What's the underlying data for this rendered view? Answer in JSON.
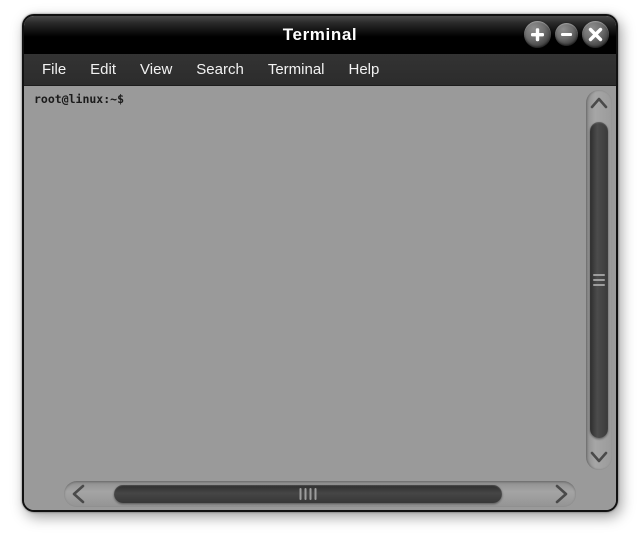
{
  "window": {
    "title": "Terminal",
    "controls": [
      {
        "name": "maximize-button",
        "icon": "plus-icon"
      },
      {
        "name": "minimize-button",
        "icon": "minus-icon"
      },
      {
        "name": "close-button",
        "icon": "close-icon"
      }
    ]
  },
  "menubar": {
    "items": [
      {
        "label": "File"
      },
      {
        "label": "Edit"
      },
      {
        "label": "View"
      },
      {
        "label": "Search"
      },
      {
        "label": "Terminal"
      },
      {
        "label": "Help"
      }
    ]
  },
  "terminal": {
    "prompt": "root@linux:~$",
    "lines": [
      "root@linux:~$"
    ],
    "background_color": "#9a9a9a",
    "text_color": "#1b1b1b"
  },
  "scrollbars": {
    "vertical": {
      "up_arrow_icon": "chevron-up-icon",
      "down_arrow_icon": "chevron-down-icon",
      "grip_lines": 3
    },
    "horizontal": {
      "left_arrow_icon": "chevron-left-icon",
      "right_arrow_icon": "chevron-right-icon",
      "grip_lines": 4
    }
  },
  "colors": {
    "titlebar": "#000000",
    "menubar": "#2f2f2f",
    "frame": "#9a9a9a",
    "border": "#111111",
    "desktop": "#ffffff"
  }
}
